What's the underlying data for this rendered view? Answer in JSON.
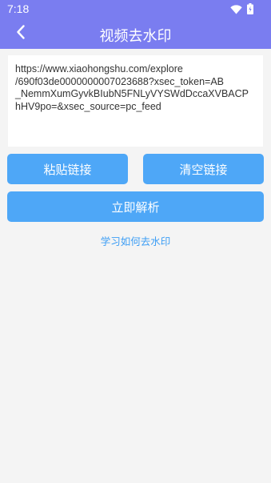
{
  "status_bar": {
    "time": "7:18",
    "icons": [
      "wifi-icon",
      "battery-icon"
    ]
  },
  "header": {
    "title": "视频去水印",
    "back_icon": "chevron-left-icon"
  },
  "url_input": {
    "lines": [
      "https://www.xiaohongshu.com/explore",
      "/690f03de0000000007023688?xsec_token=AB",
      "_NemmXumGyvkBIubN5FNLyVYSWdDccaXVBACP",
      "hHV9po=&xsec_source=pc_feed"
    ]
  },
  "buttons": {
    "paste": "粘贴链接",
    "clear": "清空链接",
    "parse": "立即解析"
  },
  "learn_link": "学习如何去水印",
  "colors": {
    "header": "#7a7df0",
    "button": "#4ea7f7",
    "link": "#3d9ef5",
    "background": "#f4f4f4"
  }
}
